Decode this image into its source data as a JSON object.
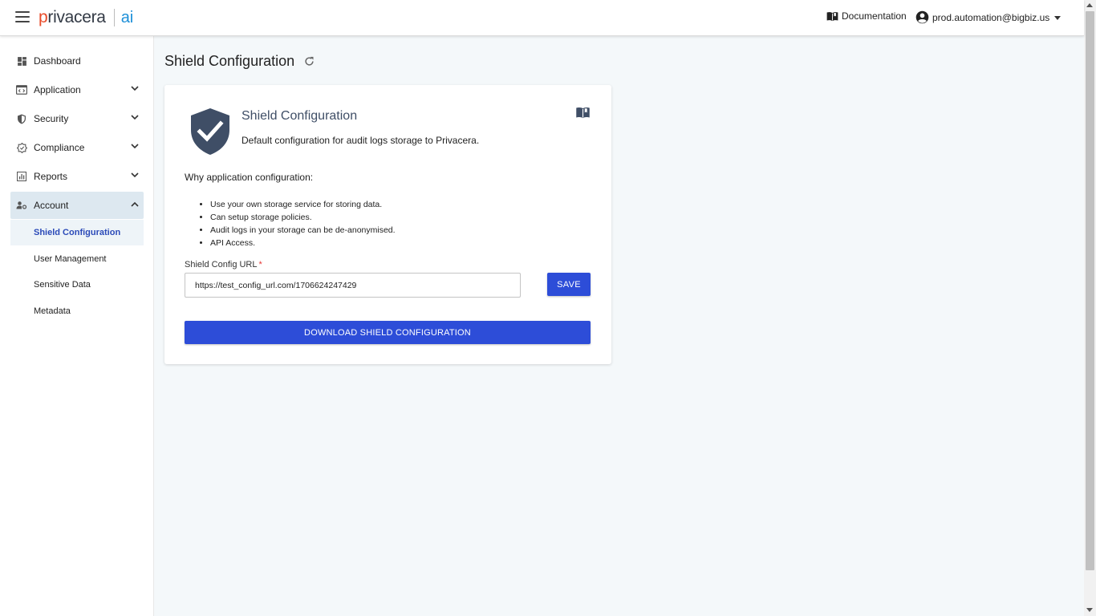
{
  "header": {
    "logo_main": "rivacera",
    "logo_p": "p",
    "logo_ai": "ai",
    "documentation_label": "Documentation",
    "user_email": "prod.automation@bigbiz.us"
  },
  "sidebar": {
    "items": [
      {
        "label": "Dashboard",
        "icon": "dashboard-icon"
      },
      {
        "label": "Application",
        "icon": "application-icon"
      },
      {
        "label": "Security",
        "icon": "security-shield-icon"
      },
      {
        "label": "Compliance",
        "icon": "compliance-badge-icon"
      },
      {
        "label": "Reports",
        "icon": "reports-chart-icon"
      },
      {
        "label": "Account",
        "icon": "account-settings-icon"
      }
    ],
    "sub_items": [
      {
        "label": "Shield Configuration"
      },
      {
        "label": "User Management"
      },
      {
        "label": "Sensitive Data"
      },
      {
        "label": "Metadata"
      }
    ]
  },
  "main": {
    "page_title": "Shield Configuration",
    "card": {
      "title": "Shield Configuration",
      "description": "Default configuration for audit logs storage to Privacera.",
      "why_heading": "Why application configuration:",
      "bullets": [
        "Use your own storage service for storing data.",
        "Can setup storage policies.",
        "Audit logs in your storage can be de-anonymised.",
        "API Access."
      ],
      "field_label": "Shield Config URL",
      "required_mark": "*",
      "url_value": "https://test_config_url.com/1706624247429",
      "save_label": "SAVE",
      "download_label": "DOWNLOAD SHIELD CONFIGURATION"
    }
  },
  "colors": {
    "primary": "#2d4dd8",
    "shield": "#3f4e66",
    "active_nav_bg": "#dde8f0"
  }
}
